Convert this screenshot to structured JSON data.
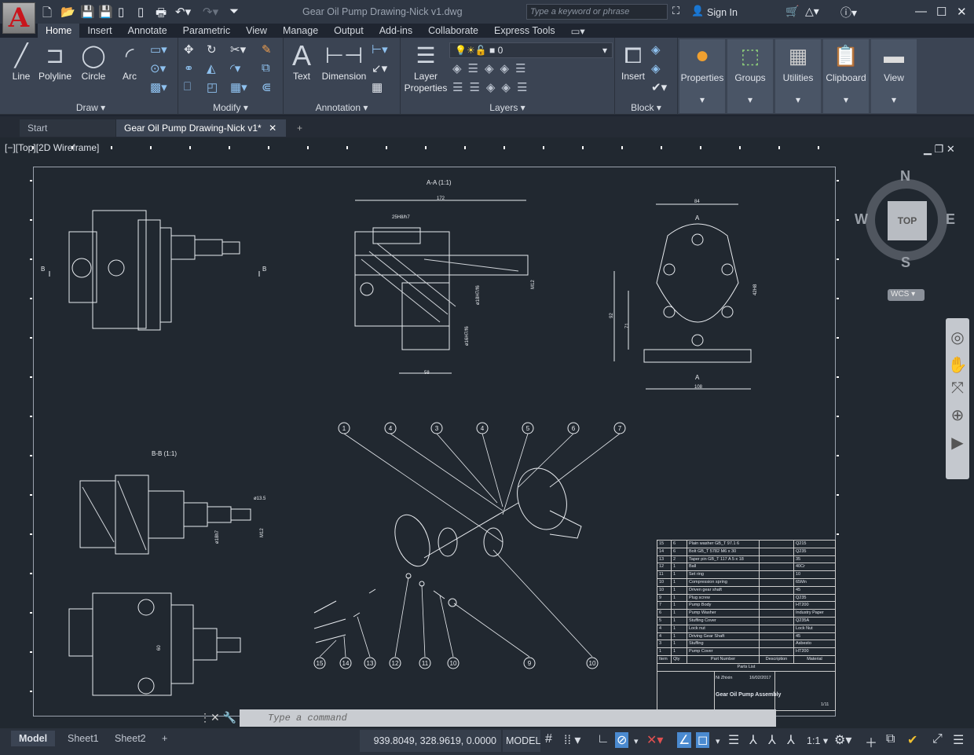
{
  "app": {
    "title": "Gear Oil Pump Drawing-Nick v1.dwg",
    "search_placeholder": "Type a keyword or phrase",
    "sign_in": "Sign In",
    "logo": "A"
  },
  "ribbon_tabs": [
    "Home",
    "Insert",
    "Annotate",
    "Parametric",
    "View",
    "Manage",
    "Output",
    "Add-ins",
    "Collaborate",
    "Express Tools"
  ],
  "draw": {
    "title": "Draw",
    "line": "Line",
    "polyline": "Polyline",
    "circle": "Circle",
    "arc": "Arc"
  },
  "modify": {
    "title": "Modify"
  },
  "annotation": {
    "title": "Annotation",
    "text": "Text",
    "dimension": "Dimension"
  },
  "layers": {
    "title": "Layers",
    "layer_properties": "Layer Properties",
    "current_layer": "0"
  },
  "block": {
    "title": "Block",
    "insert": "Insert"
  },
  "big_buttons": [
    "Properties",
    "Groups",
    "Utilities",
    "Clipboard",
    "View"
  ],
  "doc_tabs": {
    "start": "Start",
    "active": "Gear Oil Pump Drawing-Nick v1*",
    "close": "✕",
    "add": "+"
  },
  "viewport": {
    "label": "[−][Top][2D Wireframe]"
  },
  "viewcube": {
    "n": "N",
    "s": "S",
    "e": "E",
    "w": "W",
    "face": "TOP",
    "wcs": "WCS"
  },
  "drawing": {
    "section_aa": "A-A (1:1)",
    "section_bb": "B-B (1:1)",
    "dims": {
      "d172": "172",
      "d84": "84",
      "d58": "58",
      "d108": "108",
      "d92": "92",
      "d71": "71",
      "d42": "42H8",
      "d25": "25H8/h7",
      "m12": "M12",
      "d18": "ø18H7/f6",
      "d16": "ø16H7/f6",
      "d135": "ø13.5",
      "d18h": "ø18h7",
      "m12b": "M12",
      "d60": "60"
    },
    "marks": {
      "a": "A",
      "b": "B"
    },
    "balloons_top": [
      "1",
      "4",
      "3",
      "4",
      "5",
      "6",
      "7"
    ],
    "balloons_bottom": [
      "15",
      "14",
      "13",
      "12",
      "11",
      "10",
      "9",
      "10"
    ]
  },
  "parts_list": {
    "rows": [
      [
        "15",
        "6",
        "Plain washer GB_T 97.1 6",
        "",
        "Q215"
      ],
      [
        "14",
        "6",
        "Bolt GB_T 5782 M6 x 30",
        "",
        "Q235"
      ],
      [
        "13",
        "2",
        "Taper pin GB_T 117 A 5 x 18",
        "",
        "35"
      ],
      [
        "12",
        "1",
        "Ball",
        "",
        "40Cr"
      ],
      [
        "11",
        "1",
        "Set ring",
        "",
        "10"
      ],
      [
        "10",
        "1",
        "Compression spring",
        "",
        "65Mn"
      ],
      [
        "10",
        "1",
        "Driven gear shaft",
        "",
        "45"
      ],
      [
        "9",
        "1",
        "Plug screw",
        "",
        "Q235"
      ],
      [
        "7",
        "1",
        "Pump Body",
        "",
        "HT200"
      ],
      [
        "6",
        "1",
        "Pump Washer",
        "",
        "Industry Paper"
      ],
      [
        "5",
        "1",
        "Stuffing Cover",
        "",
        "Q235A"
      ],
      [
        "4",
        "1",
        "Lock nut",
        "",
        "Lock Nut"
      ],
      [
        "4",
        "1",
        "Driving Gear Shaft",
        "",
        "45"
      ],
      [
        "3",
        "1",
        "Stuffing",
        "",
        "Asbesto"
      ],
      [
        "1",
        "1",
        "Pump Cover",
        "",
        "HT200"
      ]
    ],
    "headers": [
      "Item",
      "Qty",
      "Part Number",
      "Description",
      "Material"
    ],
    "title": "Parts List",
    "designer": "Ni Zhixin",
    "date": "16/02/2017",
    "drawing_title": "Gear Oil Pump Assembly",
    "sheet": "1/11"
  },
  "command": {
    "placeholder": "Type a command"
  },
  "layout_tabs": [
    "Model",
    "Sheet1",
    "Sheet2",
    "+"
  ],
  "status": {
    "coords": "939.8049, 328.9619, 0.0000",
    "model": "MODEL",
    "scale": "1:1"
  }
}
